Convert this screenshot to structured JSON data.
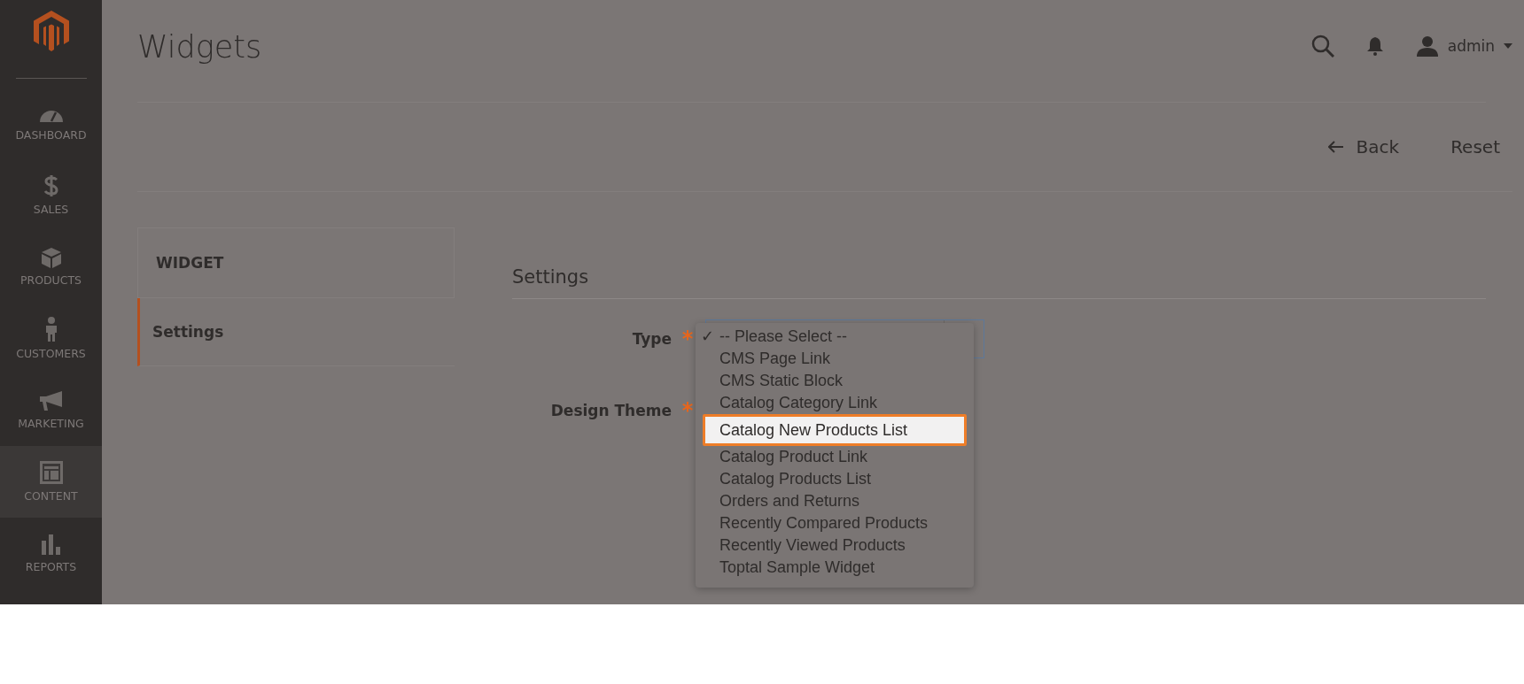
{
  "sidebar": {
    "items": [
      {
        "label": "DASHBOARD",
        "selected": false
      },
      {
        "label": "SALES",
        "selected": false
      },
      {
        "label": "PRODUCTS",
        "selected": false
      },
      {
        "label": "CUSTOMERS",
        "selected": false
      },
      {
        "label": "MARKETING",
        "selected": false
      },
      {
        "label": "CONTENT",
        "selected": true
      },
      {
        "label": "REPORTS",
        "selected": false
      }
    ]
  },
  "header": {
    "title": "Widgets",
    "user": "admin"
  },
  "actions": [
    {
      "label": "Back",
      "kind": "back"
    },
    {
      "label": "Reset",
      "kind": "plain"
    }
  ],
  "tabs_panel": {
    "title": "WIDGET",
    "tabs": [
      {
        "label": "Settings",
        "selected": true
      }
    ]
  },
  "section": {
    "title": "Settings"
  },
  "fields": [
    {
      "label": "Type",
      "required": true
    },
    {
      "label": "Design Theme",
      "required": true
    }
  ],
  "dropdown": {
    "options": [
      {
        "label": "-- Please Select --",
        "checked": true,
        "highlighted": false
      },
      {
        "label": "CMS Page Link",
        "checked": false,
        "highlighted": false
      },
      {
        "label": "CMS Static Block",
        "checked": false,
        "highlighted": false
      },
      {
        "label": "Catalog Category Link",
        "checked": false,
        "highlighted": false
      },
      {
        "label": "Catalog New Products List",
        "checked": false,
        "highlighted": true
      },
      {
        "label": "Catalog Product Link",
        "checked": false,
        "highlighted": false
      },
      {
        "label": "Catalog Products List",
        "checked": false,
        "highlighted": false
      },
      {
        "label": "Orders and Returns",
        "checked": false,
        "highlighted": false
      },
      {
        "label": "Recently Compared Products",
        "checked": false,
        "highlighted": false
      },
      {
        "label": "Recently Viewed Products",
        "checked": false,
        "highlighted": false
      },
      {
        "label": "Toptal Sample Widget",
        "checked": false,
        "highlighted": false
      }
    ]
  },
  "checkmark": "✓",
  "required_mark": "*"
}
